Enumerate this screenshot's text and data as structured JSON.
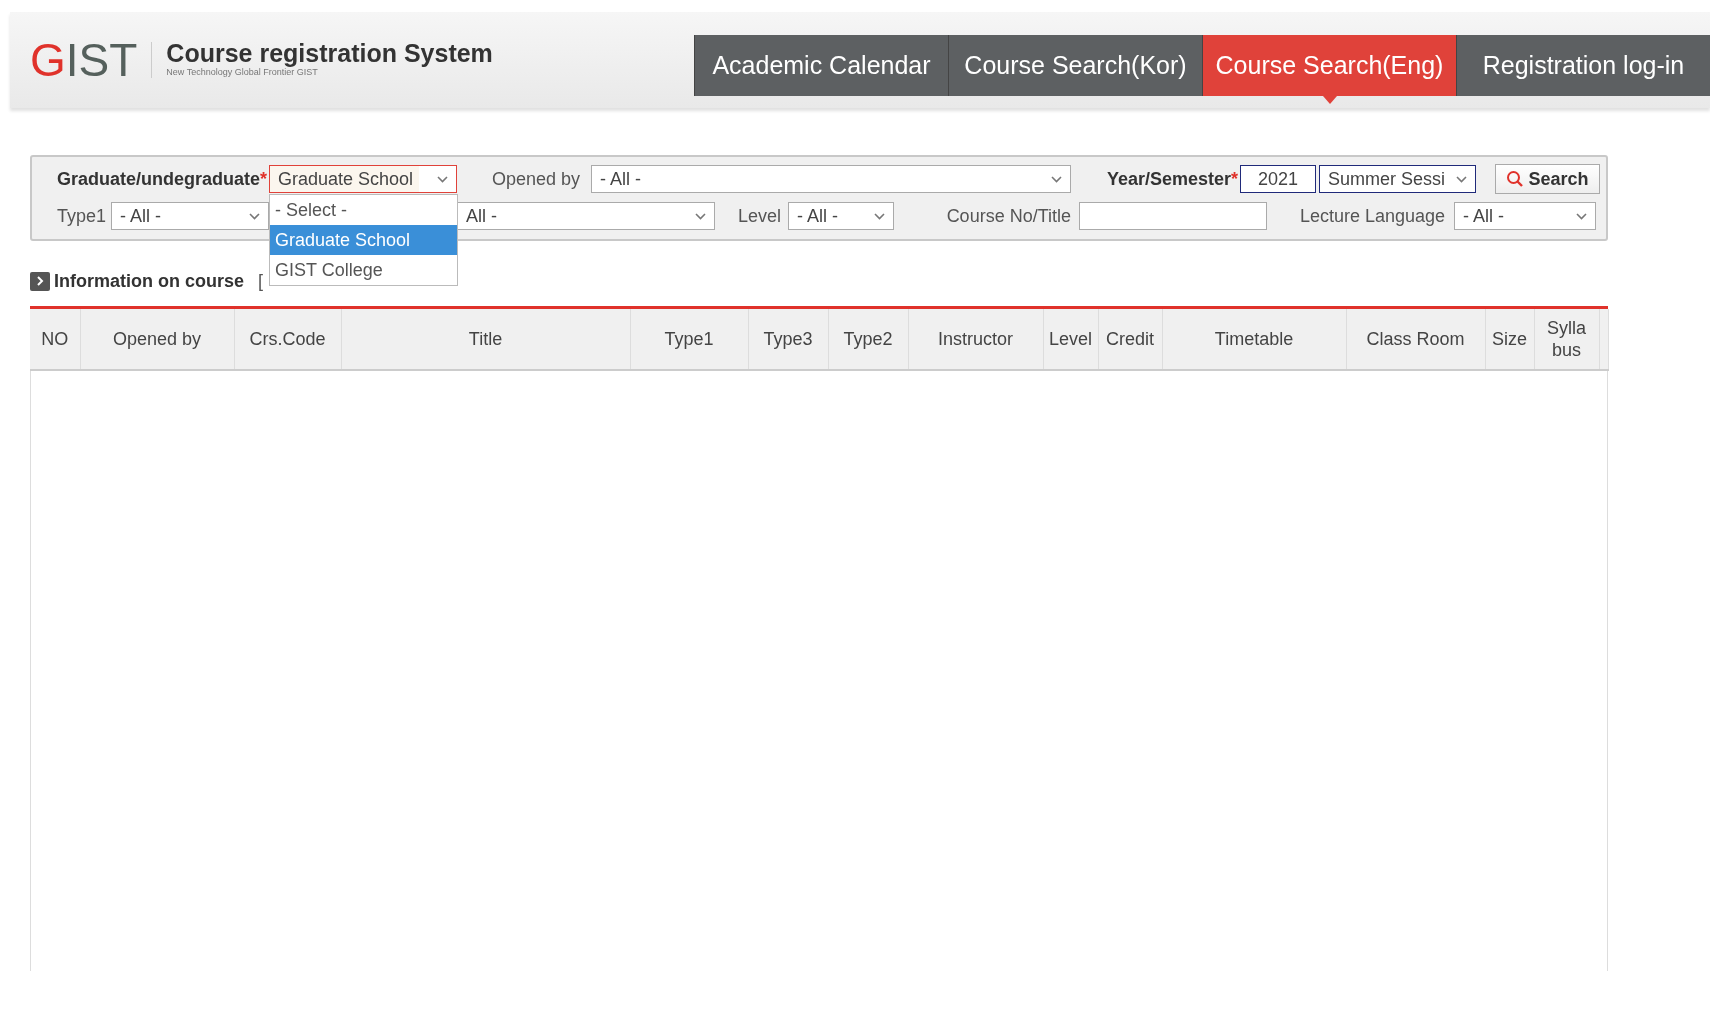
{
  "header": {
    "logo": "GIST",
    "title": "Course registration System",
    "subtitle": "New Technology Global Frontier GIST"
  },
  "nav": [
    {
      "label": "Academic Calendar",
      "selected": false
    },
    {
      "label": "Course Search(Kor)",
      "selected": false
    },
    {
      "label": "Course Search(Eng)",
      "selected": true
    },
    {
      "label": "Registration log-in",
      "selected": false
    }
  ],
  "filters": {
    "row_1": [
      {
        "kind": "label",
        "text": "Graduate/undegraduate",
        "bold": true,
        "required_mark": "*"
      },
      {
        "kind": "select",
        "value": "Graduate School",
        "focused": true,
        "options": [
          {
            "label": "- Select -",
            "selected": false
          },
          {
            "label": "Graduate School",
            "selected": true
          },
          {
            "label": "GIST College",
            "selected": false
          }
        ]
      },
      {
        "kind": "label",
        "text": "Opened by",
        "bold": false
      },
      {
        "kind": "select",
        "value": "- All -",
        "focused": false
      },
      {
        "kind": "label",
        "text": "Year/Semester",
        "bold": true,
        "required_mark": "*"
      },
      {
        "kind": "input",
        "value": "2021",
        "required": true
      },
      {
        "kind": "select",
        "value": "Summer Sessi",
        "focused": false,
        "required": true
      },
      {
        "kind": "button",
        "text": "Search"
      }
    ],
    "row_2": [
      {
        "kind": "label",
        "text": "Type1",
        "bold": false
      },
      {
        "kind": "select",
        "value": "- All -",
        "focused": false
      },
      {
        "kind": "select",
        "value": "All -",
        "focused": false
      },
      {
        "kind": "label",
        "text": "Level",
        "bold": false
      },
      {
        "kind": "select",
        "value": "- All -",
        "focused": false
      },
      {
        "kind": "label",
        "text": "Course No/Title",
        "bold": false
      },
      {
        "kind": "input",
        "required": false
      },
      {
        "kind": "label",
        "text": "Lecture Language",
        "bold": false
      },
      {
        "kind": "select",
        "value": "- All -",
        "focused": false
      }
    ]
  },
  "info": {
    "title": "Information on course",
    "bracket": "["
  },
  "table": {
    "columns": [
      {
        "label": "NO"
      },
      {
        "label": "Opened by"
      },
      {
        "label": "Crs.Code"
      },
      {
        "label": "Title"
      },
      {
        "label": "Type1"
      },
      {
        "label": "Type3"
      },
      {
        "label": "Type2"
      },
      {
        "label": "Instructor"
      },
      {
        "label": "Level"
      },
      {
        "label": "Credit"
      },
      {
        "label": "Timetable"
      },
      {
        "label": "Class Room"
      },
      {
        "label": "Size"
      },
      {
        "label": "Sylla bus"
      }
    ]
  }
}
